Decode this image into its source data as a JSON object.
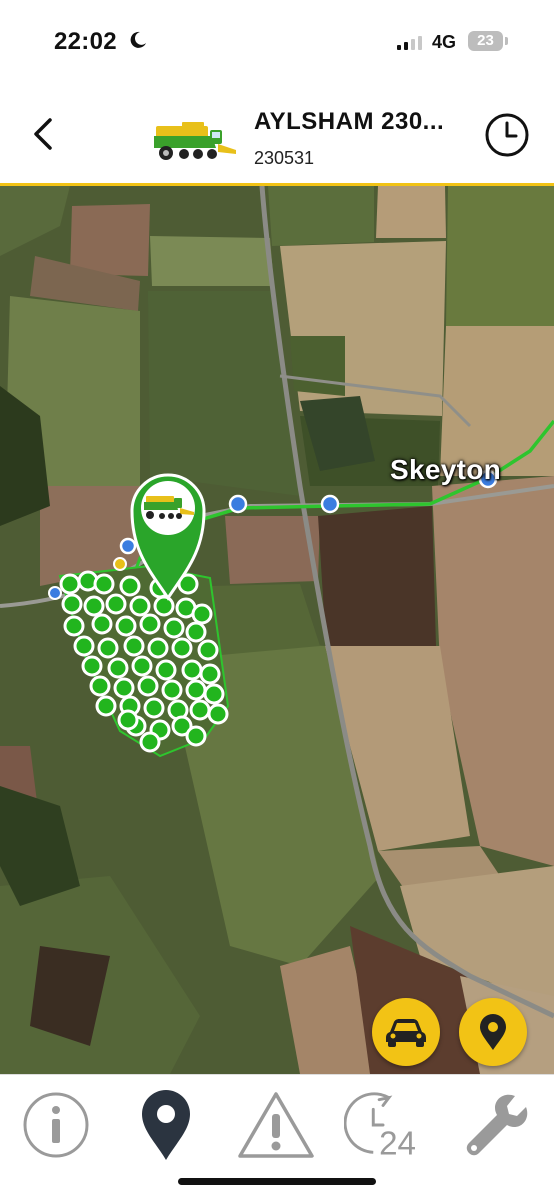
{
  "status_bar": {
    "time": "22:02",
    "network": "4G",
    "battery": "23"
  },
  "header": {
    "title": "AYLSHAM 230...",
    "subtitle": "230531"
  },
  "map": {
    "place_label": "Skeyton"
  },
  "colors": {
    "accent": "#f2c315",
    "track_green": "#2ec52e",
    "point_green": "#22b51e",
    "point_blue": "#3b7de0"
  },
  "icons": {
    "back": "chevron-left-icon",
    "vehicle": "combine-harvester-icon",
    "history": "clock-icon",
    "car": "car-icon",
    "pin": "map-pin-icon",
    "info": "info-icon",
    "location": "location-pin-icon",
    "alerts": "warning-icon",
    "history24": "history-24-icon",
    "settings": "wrench-icon"
  },
  "bottom_nav": {
    "history24_label": "24"
  }
}
